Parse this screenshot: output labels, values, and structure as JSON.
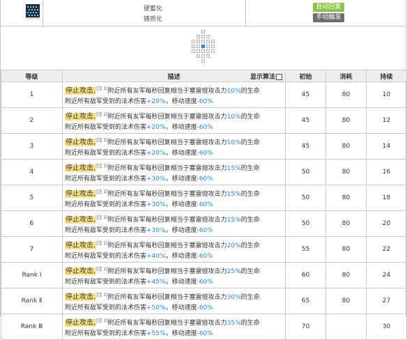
{
  "header": {
    "tags": [
      "硬蓄化",
      "铸质化"
    ],
    "badges": [
      "自动回复",
      "手动触发"
    ]
  },
  "table": {
    "columns": {
      "level": "等级",
      "description": "描述",
      "show_formula": "显示算法",
      "initial": "初始",
      "cost": "消耗",
      "duration": "持续"
    },
    "rows": [
      {
        "level": "1",
        "stop": "停止攻击,",
        "note": "[注 1]",
        "text1": "附近所有友军每秒回复相当于塞雷娅攻击力",
        "heal": "10%",
        "text2": "的生命",
        "text3": "附近所有敌军受到的法术伤害",
        "dmg": "+20%",
        "text4": "，移动速度",
        "spd": "-60%",
        "initial": "45",
        "cost": "80",
        "duration": "10"
      },
      {
        "level": "2",
        "stop": "停止攻击,",
        "note": "[注 1]",
        "text1": "附近所有友军每秒回复相当于塞雷娅攻击力",
        "heal": "10%",
        "text2": "的生命",
        "text3": "附近所有敌军受到的法术伤害",
        "dmg": "+20%",
        "text4": "，移动速度",
        "spd": "-60%",
        "initial": "45",
        "cost": "80",
        "duration": "12"
      },
      {
        "level": "3",
        "stop": "停止攻击,",
        "note": "[注 1]",
        "text1": "附近所有友军每秒回复相当于塞雷娅攻击力",
        "heal": "10%",
        "text2": "的生命",
        "text3": "附近所有敌军受到的法术伤害",
        "dmg": "+20%",
        "text4": "，移动速度",
        "spd": "-60%",
        "initial": "45",
        "cost": "80",
        "duration": "14"
      },
      {
        "level": "4",
        "stop": "停止攻击,",
        "note": "[注 1]",
        "text1": "附近所有友军每秒回复相当于塞雷娅攻击力",
        "heal": "15%",
        "text2": "的生命",
        "text3": "附近所有敌军受到的法术伤害",
        "dmg": "+30%",
        "text4": "，移动速度",
        "spd": "-60%",
        "initial": "50",
        "cost": "80",
        "duration": "16"
      },
      {
        "level": "5",
        "stop": "停止攻击,",
        "note": "[注 1]",
        "text1": "附近所有友军每秒回复相当于塞雷娅攻击力",
        "heal": "15%",
        "text2": "的生命",
        "text3": "附近所有敌军受到的法术伤害",
        "dmg": "+30%",
        "text4": "，移动速度",
        "spd": "-60%",
        "initial": "50",
        "cost": "80",
        "duration": "18"
      },
      {
        "level": "6",
        "stop": "停止攻击,",
        "note": "[注 1]",
        "text1": "附近所有友军每秒回复相当于塞雷娅攻击力",
        "heal": "15%",
        "text2": "的生命",
        "text3": "附近所有敌军受到的法术伤害",
        "dmg": "+30%",
        "text4": "，移动速度",
        "spd": "-60%",
        "initial": "50",
        "cost": "80",
        "duration": "20"
      },
      {
        "level": "7",
        "stop": "停止攻击,",
        "note": "[注 1]",
        "text1": "附近所有友军每秒回复相当于塞雷娅攻击力",
        "heal": "20%",
        "text2": "的生命",
        "text3": "附近所有敌军受到的法术伤害",
        "dmg": "+40%",
        "text4": "，移动速度",
        "spd": "-60%",
        "initial": "55",
        "cost": "80",
        "duration": "22"
      },
      {
        "level": "Rank Ⅰ",
        "stop": "停止攻击,",
        "note": "[注 1]",
        "text1": "附近所有友军每秒回复相当于塞雷娅攻击力",
        "heal": "25%",
        "text2": "的生命",
        "text3": "附近所有敌军受到的法术伤害",
        "dmg": "+45%",
        "text4": "，移动速度",
        "spd": "-60%",
        "initial": "60",
        "cost": "80",
        "duration": "24"
      },
      {
        "level": "Rank Ⅱ",
        "stop": "停止攻击,",
        "note": "[注 1]",
        "text1": "附近所有友军每秒回复相当于塞雷娅攻击力",
        "heal": "30%",
        "text2": "的生命",
        "text3": "附近所有敌军受到的法术伤害",
        "dmg": "+50%",
        "text4": "，移动速度",
        "spd": "-60%",
        "initial": "65",
        "cost": "80",
        "duration": "27"
      },
      {
        "level": "Rank Ⅲ",
        "stop": "停止攻击,",
        "note": "[注 1]",
        "text1": "附近所有友军每秒回复相当于塞雷娅攻击力",
        "heal": "35%",
        "text2": "的生命",
        "text3": "附近所有敌军受到的法术伤害",
        "dmg": "+55%",
        "text4": "，移动速度",
        "spd": "-60%",
        "initial": "70",
        "cost": "",
        "duration": "30"
      }
    ]
  },
  "colors": {
    "highlight": "#fde48a",
    "value_blue": "#1e88e5",
    "badge_auto": "#8bc34a",
    "badge_manual": "#6d6d6d"
  }
}
